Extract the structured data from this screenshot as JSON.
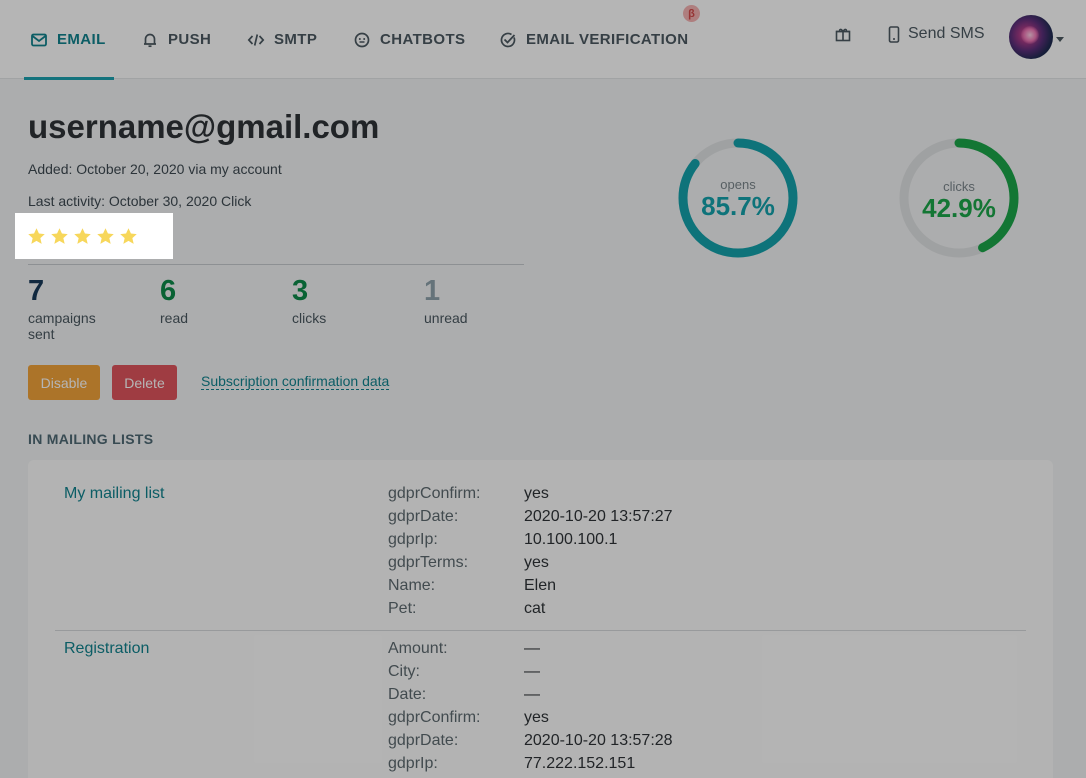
{
  "nav": {
    "items": [
      {
        "label": "EMAIL",
        "icon": "mail-icon"
      },
      {
        "label": "PUSH",
        "icon": "bell-icon"
      },
      {
        "label": "SMTP",
        "icon": "code-icon"
      },
      {
        "label": "CHATBOTS",
        "icon": "chatbot-icon"
      },
      {
        "label": "EMAIL VERIFICATION",
        "icon": "check-circle-icon"
      }
    ],
    "beta_badge": "β",
    "send_sms": "Send SMS"
  },
  "subscriber": {
    "email": "username@gmail.com",
    "added": "Added: October 20, 2020 via my account",
    "last_activity": "Last activity: October 30, 2020 Click",
    "rating": 5,
    "rating_max": 5
  },
  "stats": [
    {
      "value": "7",
      "label": "campaigns sent",
      "color": "#17395a"
    },
    {
      "value": "6",
      "label": "read",
      "color": "#0e8a4a"
    },
    {
      "value": "3",
      "label": "clicks",
      "color": "#0e8a4a"
    },
    {
      "value": "1",
      "label": "unread",
      "color": "#8fa3ad"
    }
  ],
  "buttons": {
    "disable": "Disable",
    "delete": "Delete",
    "confirmation_link": "Subscription confirmation data"
  },
  "gauges": [
    {
      "label": "opens",
      "value": 85.7,
      "display": "85.7%",
      "color": "#14a3ad"
    },
    {
      "label": "clicks",
      "value": 42.9,
      "display": "42.9%",
      "color": "#1ba64a"
    }
  ],
  "mailing": {
    "section_title": "IN MAILING LISTS",
    "lists": [
      {
        "name": "My mailing list",
        "fields": [
          {
            "key": "gdprConfirm:",
            "value": "yes"
          },
          {
            "key": "gdprDate:",
            "value": "2020-10-20 13:57:27"
          },
          {
            "key": "gdprIp:",
            "value": "10.100.100.1"
          },
          {
            "key": "gdprTerms:",
            "value": "yes"
          },
          {
            "key": "Name:",
            "value": "Elen"
          },
          {
            "key": "Pet:",
            "value": "cat"
          }
        ]
      },
      {
        "name": "Registration",
        "fields": [
          {
            "key": "Amount:",
            "value": "—"
          },
          {
            "key": "City:",
            "value": "—"
          },
          {
            "key": "Date:",
            "value": "—"
          },
          {
            "key": "gdprConfirm:",
            "value": "yes"
          },
          {
            "key": "gdprDate:",
            "value": "2020-10-20 13:57:28"
          },
          {
            "key": "gdprIp:",
            "value": "77.222.152.151"
          }
        ]
      }
    ]
  }
}
